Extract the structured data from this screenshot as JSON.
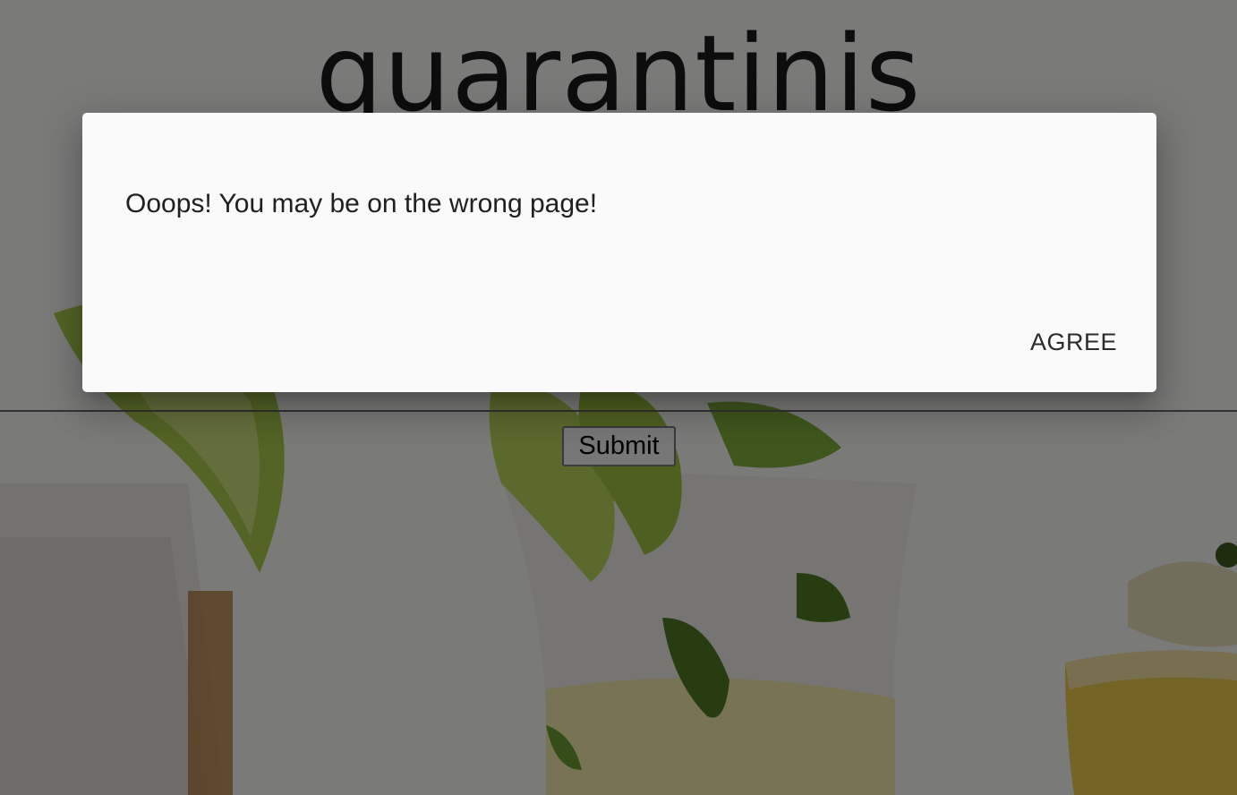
{
  "site": {
    "title": "quarantinis"
  },
  "form": {
    "submit_label": "Submit"
  },
  "dialog": {
    "message": "Ooops! You may be on the wrong page!",
    "agree_label": "AGREE"
  },
  "colors": {
    "backdrop": "rgba(0,0,0,0.5)",
    "dialog_bg": "#fafafa",
    "lime": "#9bc23c",
    "mint": "#4f8a2a"
  },
  "background_image": {
    "subject": "cocktail-glasses-with-lime-and-mint"
  }
}
